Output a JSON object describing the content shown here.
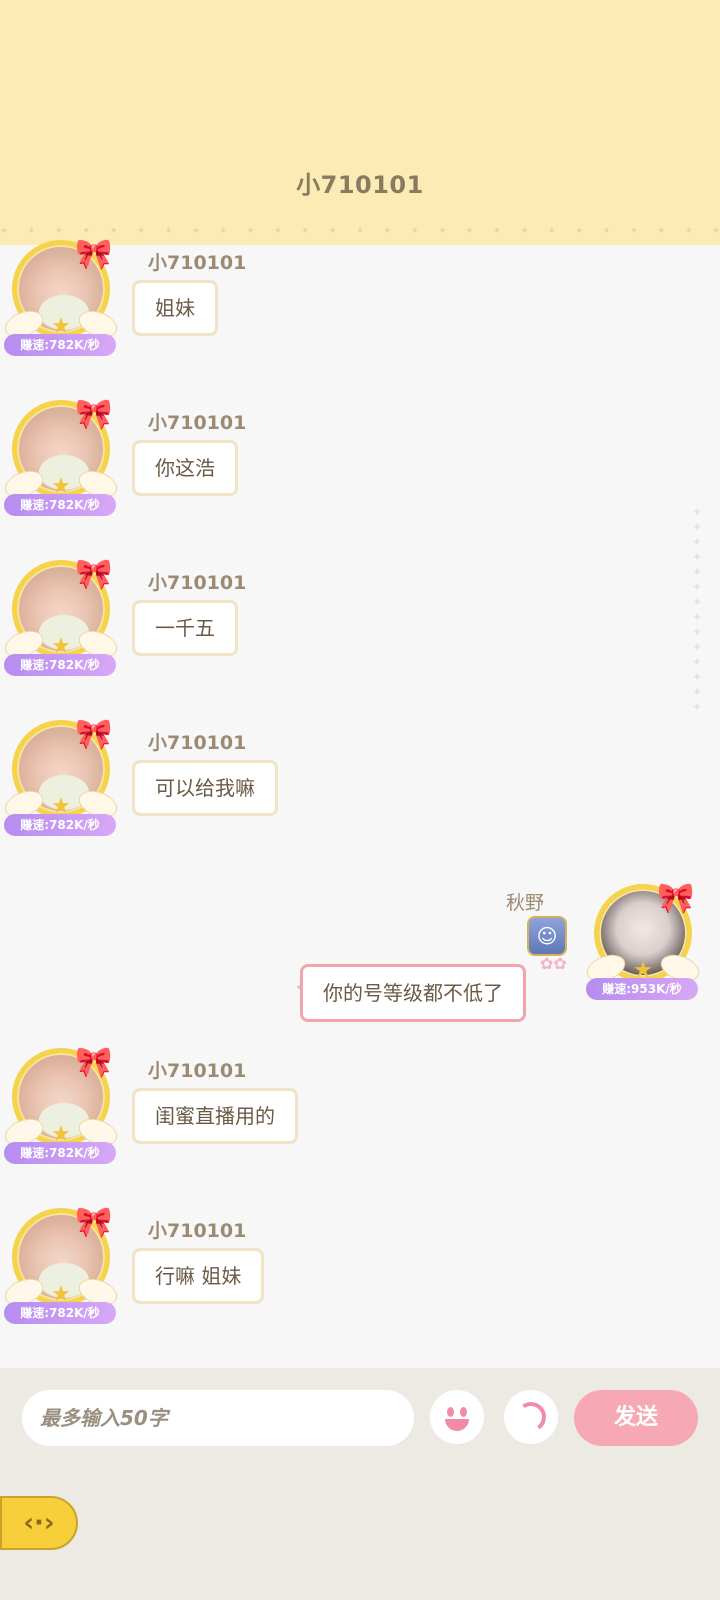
{
  "header": {
    "title": "小710101"
  },
  "messages": [
    {
      "user": "小710101",
      "speed": "赚速:782K/秒",
      "text": "姐妹"
    },
    {
      "user": "小710101",
      "speed": "赚速:782K/秒",
      "text": "你这浩"
    },
    {
      "user": "小710101",
      "speed": "赚速:782K/秒",
      "text": "一千五"
    },
    {
      "user": "小710101",
      "speed": "赚速:782K/秒",
      "text": "可以给我嘛"
    },
    {
      "user": "小710101",
      "speed": "赚速:782K/秒",
      "text": "闺蜜直播用的"
    },
    {
      "user": "小710101",
      "speed": "赚速:782K/秒",
      "text": "行嘛 姐妹"
    }
  ],
  "self_message": {
    "user": "秋野",
    "speed": "赚速:953K/秒",
    "text": "你的号等级都不低了"
  },
  "input": {
    "placeholder": "最多输入50字"
  },
  "send_button": {
    "label": "发送"
  },
  "icons": {
    "emoji": "emoji-icon",
    "voice": "voice-icon",
    "back": "back-arrow-icon",
    "bow": "pink-bow-icon",
    "wand": "magic-wand-icon"
  },
  "colors": {
    "header_bg": "#fdebb6",
    "send_bg": "#f6a9b4",
    "speed_badge": "#b58cf0"
  }
}
